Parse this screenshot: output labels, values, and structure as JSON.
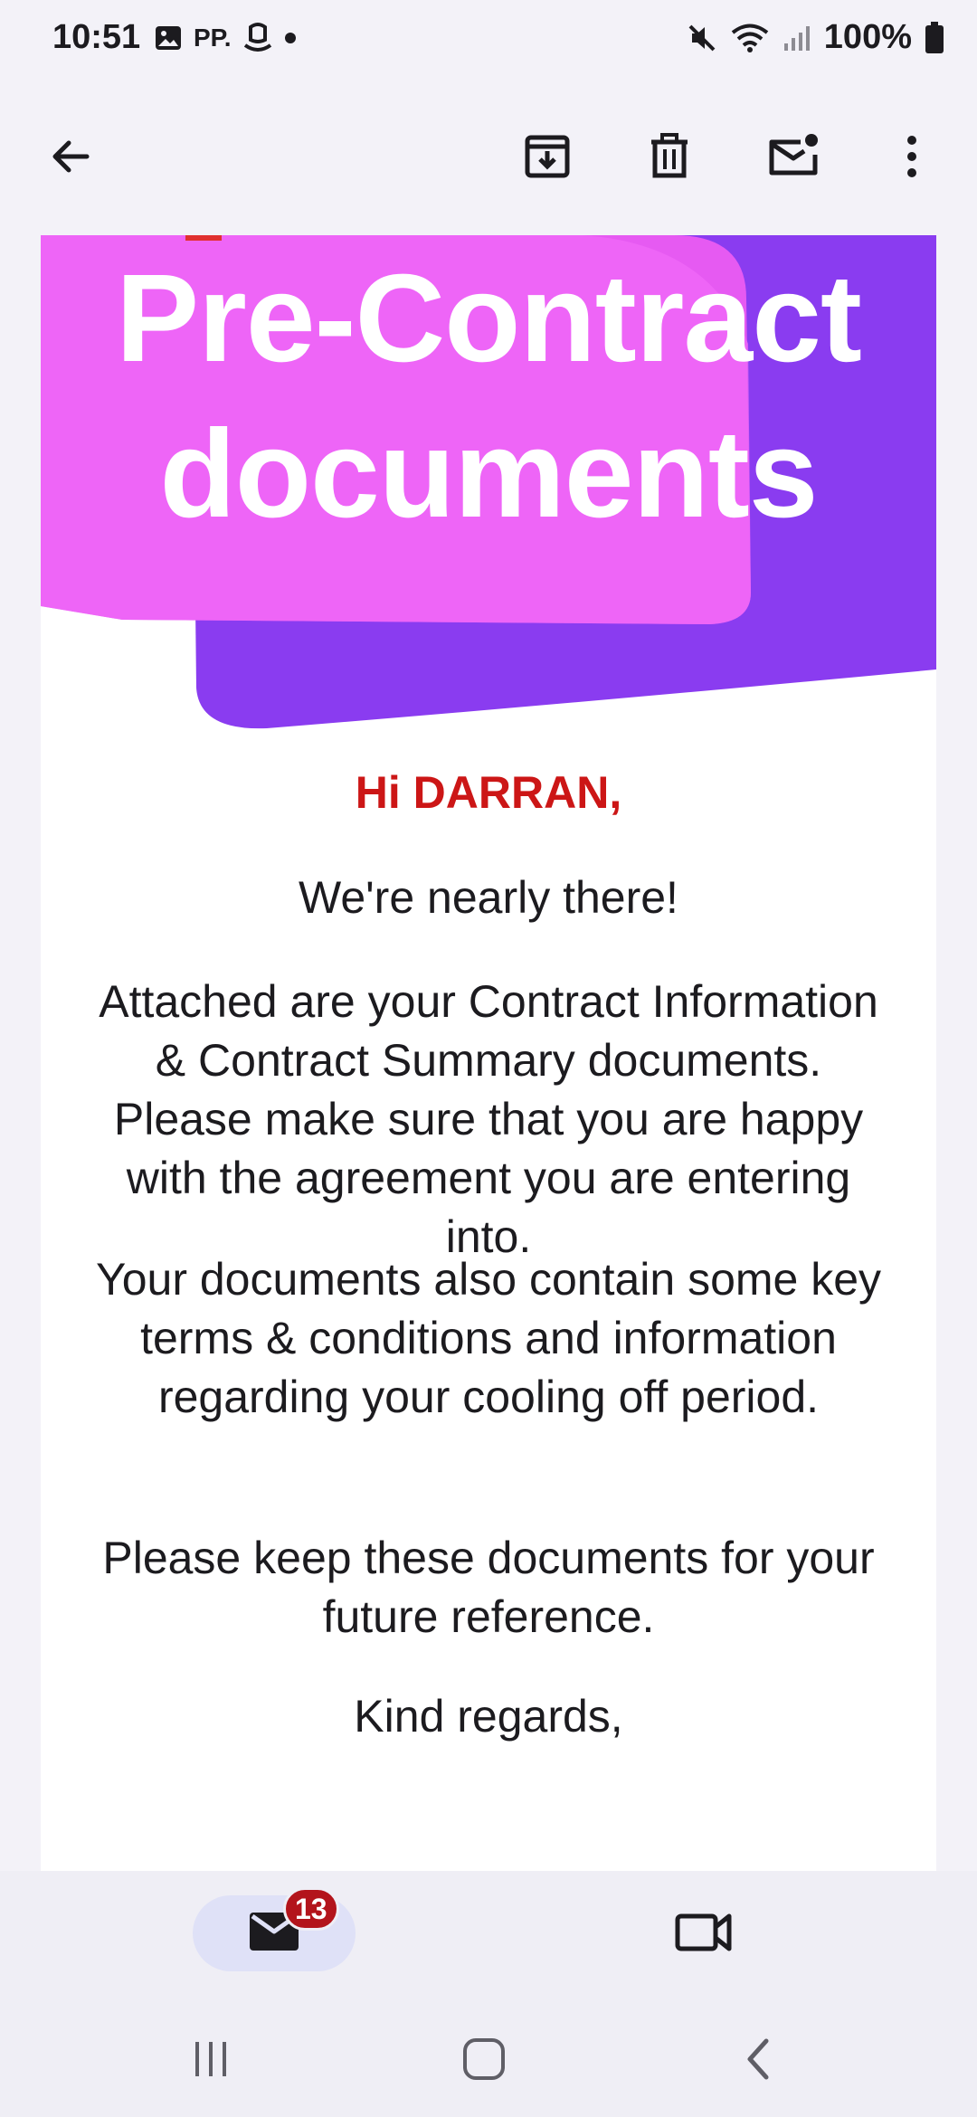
{
  "status_bar": {
    "time": "10:51",
    "pp_label": "PP.",
    "battery": "100%",
    "icons": [
      "gallery-icon",
      "amazon-icon",
      "dot-icon",
      "mute-icon",
      "wifi-icon",
      "signal-icon",
      "battery-icon"
    ]
  },
  "app_bar": {
    "actions": [
      "back-arrow-icon",
      "archive-icon",
      "delete-icon",
      "mark-unread-icon",
      "more-options-icon"
    ]
  },
  "email": {
    "banner_title_line1": "Pre-Contract",
    "banner_title_line2": "documents",
    "banner_colors": {
      "pink": "#f266f5",
      "purple": "#8a3cf0"
    },
    "greeting": "Hi DARRAN,",
    "greeting_color": "#cc1616",
    "paragraph1": "We're nearly there!",
    "paragraph2": "Attached are your Contract Information & Contract Summary documents. Please make sure that you are happy with the agreement you are entering into.",
    "paragraph3": "Your documents also contain some key terms & conditions and information regarding your cooling off period.",
    "paragraph4": "Please keep these documents for your future reference.",
    "sign_off": "Kind regards,"
  },
  "bottom_nav": {
    "mail_badge_count": "13",
    "items": [
      "mail-icon",
      "meet-video-icon"
    ]
  },
  "system_nav": {
    "items": [
      "recents-icon",
      "home-icon",
      "back-icon"
    ]
  }
}
